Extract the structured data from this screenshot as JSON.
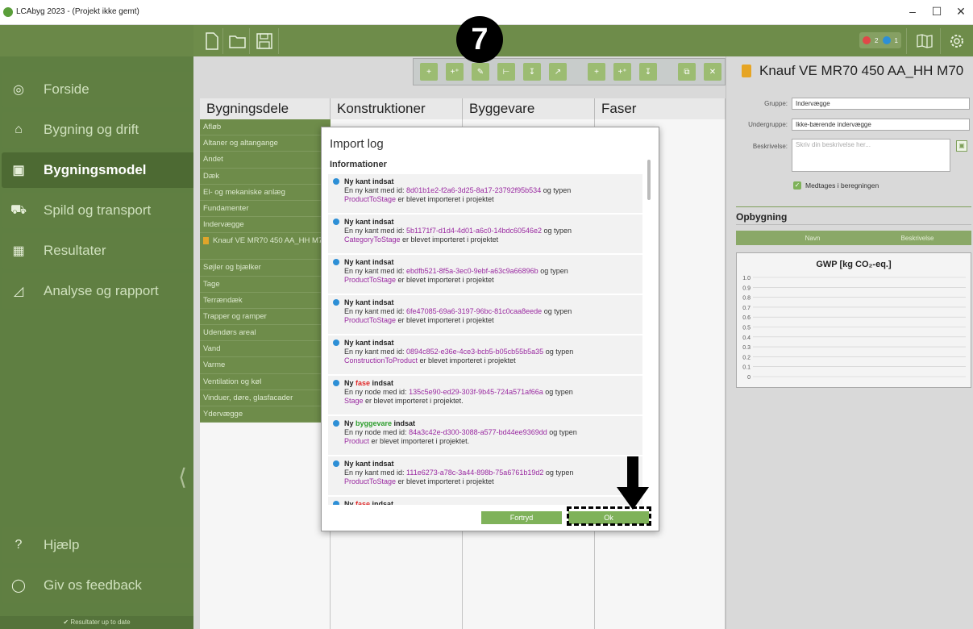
{
  "window": {
    "title": "LCAbyg 2023 - (Projekt ikke gemt)",
    "minimize": "–",
    "maximize": "☐",
    "close": "✕"
  },
  "step_number": "7",
  "badges": {
    "errors": "2",
    "infos": "1"
  },
  "sidebar": {
    "items": [
      {
        "label": "Forside",
        "icon": "dashboard-icon"
      },
      {
        "label": "Bygning og drift",
        "icon": "house-icon"
      },
      {
        "label": "Bygningsmodel",
        "icon": "building-model-icon"
      },
      {
        "label": "Spild og transport",
        "icon": "truck-icon"
      },
      {
        "label": "Resultater",
        "icon": "table-icon"
      },
      {
        "label": "Analyse og rapport",
        "icon": "chart-icon"
      }
    ],
    "help": "Hjælp",
    "feedback": "Giv os feedback",
    "status": "✔ Resultater up to date"
  },
  "columns": {
    "c1": "Bygningsdele",
    "c2": "Konstruktioner",
    "c3": "Byggevare",
    "c4": "Faser"
  },
  "bygningsdele": [
    "Afløb",
    "Altaner og altangange",
    "Andet",
    "Dæk",
    "El- og mekaniske anlæg",
    "Fundamenter",
    "Indervægge"
  ],
  "bygningsdele_sub": "Knauf VE MR70 450 AA_HH M70",
  "bygningsdele2": [
    "Søjler og bjælker",
    "Tage",
    "Terrændæk",
    "Trapper og ramper",
    "Udendørs areal",
    "Vand",
    "Varme",
    "Ventilation og køl",
    "Vinduer, døre, glasfacader",
    "Ydervægge"
  ],
  "right": {
    "title": "Knauf VE MR70 450 AA_HH M70",
    "gruppe_label": "Gruppe:",
    "gruppe": "Indervægge",
    "undergruppe_label": "Undergruppe:",
    "undergruppe": "Ikke-bærende indervægge",
    "beskrivelse_label": "Beskrivelse:",
    "beskrivelse_ph": "Skriv din beskrivelse her...",
    "medtages": "Medtages i beregningen",
    "opbygning": "Opbygning",
    "navn": "Navn",
    "beskrivelse_col": "Beskrivelse"
  },
  "chart_data": {
    "type": "line",
    "title": "GWP [kg CO₂-eq.]",
    "y_ticks": [
      "1.0",
      "0.9",
      "0.8",
      "0.7",
      "0.6",
      "0.5",
      "0.4",
      "0.3",
      "0.2",
      "0.1",
      "0"
    ],
    "ylim": [
      0,
      1
    ],
    "series": []
  },
  "modal": {
    "title": "Import log",
    "section": "Informationer",
    "entries": [
      {
        "pre": "Ny ",
        "kw": "kant",
        "kwc": "",
        "post": " indsat",
        "l1": "En ny kant med id: ",
        "id": "8d01b1e2-f2a6-3d25-8a17-23792f95b534",
        "l1b": " og typen",
        "typ": "ProductToStage",
        "l2": " er blevet importeret i projektet"
      },
      {
        "pre": "Ny ",
        "kw": "kant",
        "kwc": "",
        "post": " indsat",
        "l1": "En ny kant med id: ",
        "id": "5b1171f7-d1d4-4d01-a6c0-14bdc60546e2",
        "l1b": " og typen",
        "typ": "CategoryToStage",
        "l2": " er blevet importeret i projektet"
      },
      {
        "pre": "Ny ",
        "kw": "kant",
        "kwc": "",
        "post": " indsat",
        "l1": "En ny kant med id: ",
        "id": "ebdfb521-8f5a-3ec0-9ebf-a63c9a66896b",
        "l1b": " og typen",
        "typ": "ProductToStage",
        "l2": " er blevet importeret i projektet"
      },
      {
        "pre": "Ny ",
        "kw": "kant",
        "kwc": "",
        "post": " indsat",
        "l1": "En ny kant med id: ",
        "id": "6fe47085-69a6-3197-96bc-81c0caa8eede",
        "l1b": " og typen",
        "typ": "ProductToStage",
        "l2": " er blevet importeret i projektet"
      },
      {
        "pre": "Ny ",
        "kw": "kant",
        "kwc": "",
        "post": " indsat",
        "l1": "En ny kant med id: ",
        "id": "0894c852-e36e-4ce3-bcb5-b05cb55b5a35",
        "l1b": " og typen",
        "typ": "ConstructionToProduct",
        "l2": " er blevet importeret i projektet"
      },
      {
        "pre": "Ny ",
        "kw": "fase",
        "kwc": "red",
        "post": " indsat",
        "l1": "En ny node med id: ",
        "id": "135c5e90-ed29-303f-9b45-724a571af66a",
        "l1b": " og typen",
        "typ": "Stage",
        "l2": " er blevet importeret i projektet."
      },
      {
        "pre": "Ny ",
        "kw": "byggevare",
        "kwc": "grn",
        "post": " indsat",
        "l1": "En ny node med id: ",
        "id": "84a3c42e-d300-3088-a577-bd44ee9369dd",
        "l1b": " og typen",
        "typ": "Product",
        "l2": " er blevet importeret i projektet."
      },
      {
        "pre": "Ny ",
        "kw": "kant",
        "kwc": "",
        "post": " indsat",
        "l1": "En ny kant med id: ",
        "id": "111e6273-a78c-3a44-898b-75a6761b19d2",
        "l1b": " og typen",
        "typ": "ProductToStage",
        "l2": " er blevet importeret i projektet"
      },
      {
        "pre": "Ny ",
        "kw": "fase",
        "kwc": "red",
        "post": " indsat",
        "l1": "",
        "id": "",
        "l1b": "",
        "typ": "",
        "l2": ""
      }
    ],
    "cancel": "Fortryd",
    "ok": "Ok"
  }
}
